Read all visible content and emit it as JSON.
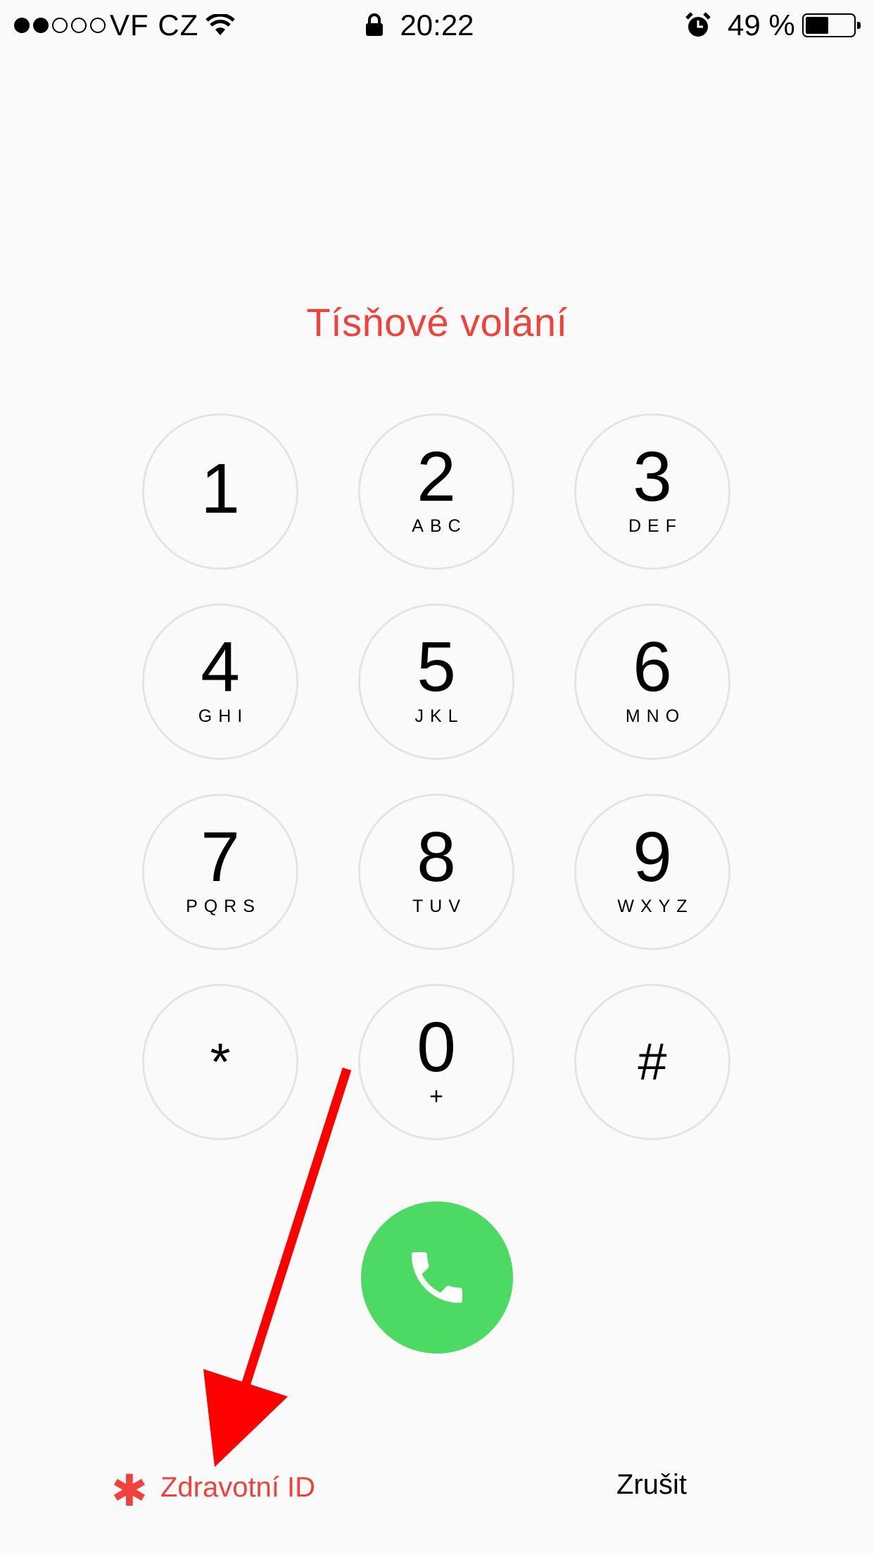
{
  "status_bar": {
    "signal_dots": {
      "filled": 2,
      "total": 5
    },
    "carrier": "VF CZ",
    "wifi_icon": "wifi-icon",
    "lock_icon": "lock-icon",
    "time": "20:22",
    "alarm_icon": "alarm-clock-icon",
    "battery_percent": "49 %",
    "battery_level": 0.49
  },
  "title": "Tísňové volání",
  "keypad": [
    {
      "digit": "1",
      "letters": ""
    },
    {
      "digit": "2",
      "letters": "ABC"
    },
    {
      "digit": "3",
      "letters": "DEF"
    },
    {
      "digit": "4",
      "letters": "GHI"
    },
    {
      "digit": "5",
      "letters": "JKL"
    },
    {
      "digit": "6",
      "letters": "MNO"
    },
    {
      "digit": "7",
      "letters": "PQRS"
    },
    {
      "digit": "8",
      "letters": "TUV"
    },
    {
      "digit": "9",
      "letters": "WXYZ"
    },
    {
      "digit": "*",
      "letters": ""
    },
    {
      "digit": "0",
      "letters": "+"
    },
    {
      "digit": "#",
      "letters": ""
    }
  ],
  "call_button": {
    "icon": "phone-icon",
    "color": "#4cd964"
  },
  "footer": {
    "medical_id_symbol": "✱",
    "medical_id_label": "Zdravotní ID",
    "cancel_label": "Zrušit"
  },
  "colors": {
    "accent_red": "#f0423a",
    "call_green": "#4cd964",
    "annotation_red": "#ff0000"
  }
}
